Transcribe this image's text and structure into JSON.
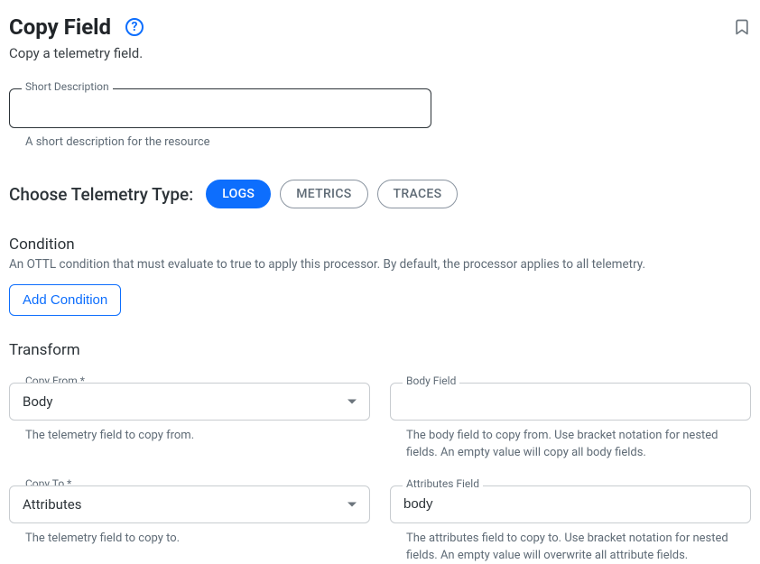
{
  "header": {
    "title": "Copy Field",
    "help_icon": "help",
    "subtitle": "Copy a telemetry field."
  },
  "short_description": {
    "label": "Short Description",
    "value": "",
    "helper": "A short description for the resource"
  },
  "telemetry": {
    "label": "Choose Telemetry Type:",
    "options": [
      {
        "key": "logs",
        "label": "LOGS",
        "active": true
      },
      {
        "key": "metrics",
        "label": "METRICS",
        "active": false
      },
      {
        "key": "traces",
        "label": "TRACES",
        "active": false
      }
    ]
  },
  "condition": {
    "title": "Condition",
    "desc": "An OTTL condition that must evaluate to true to apply this processor. By default, the processor applies to all telemetry.",
    "add_button": "Add Condition"
  },
  "transform": {
    "title": "Transform",
    "copy_from": {
      "label": "Copy From *",
      "value": "Body",
      "helper": "The telemetry field to copy from."
    },
    "body_field": {
      "label": "Body Field",
      "value": "",
      "helper": "The body field to copy from. Use bracket notation for nested fields. An empty value will copy all body fields."
    },
    "copy_to": {
      "label": "Copy To *",
      "value": "Attributes",
      "helper": "The telemetry field to copy to."
    },
    "attributes_field": {
      "label": "Attributes Field",
      "value": "body",
      "helper": "The attributes field to copy to. Use bracket notation for nested fields. An empty value will overwrite all attribute fields."
    }
  }
}
